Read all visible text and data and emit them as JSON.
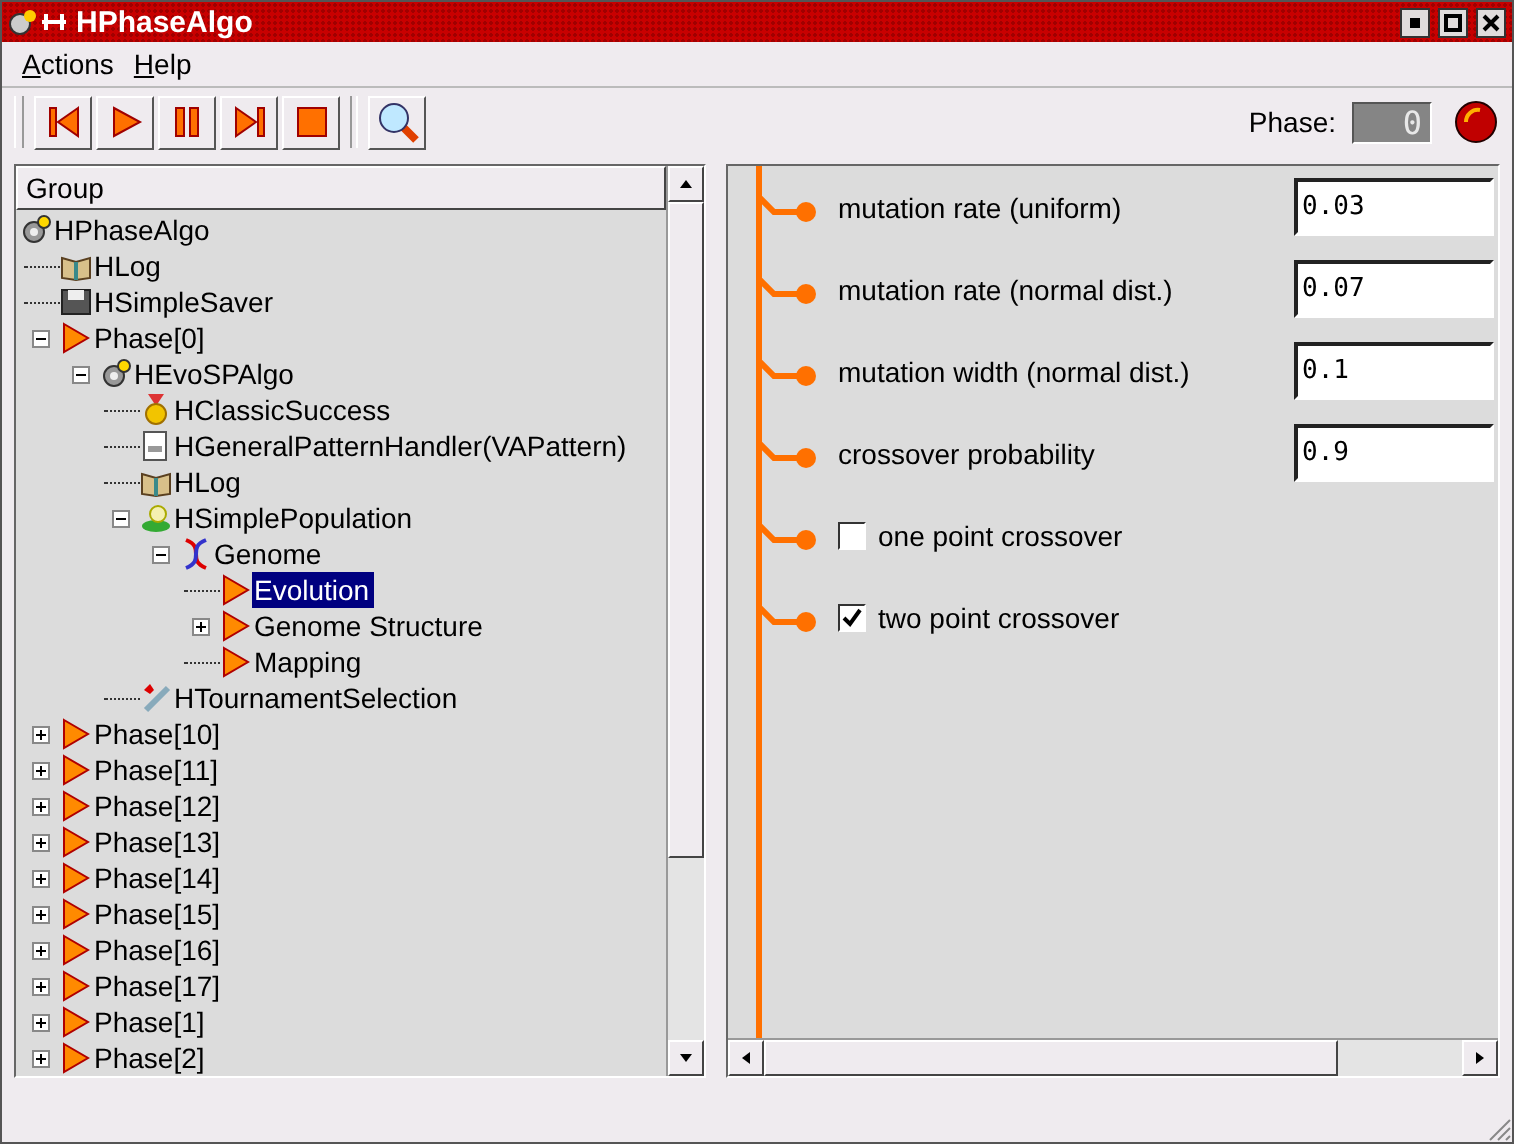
{
  "window": {
    "title": "HPhaseAlgo"
  },
  "menu": [
    {
      "label": "Actions"
    },
    {
      "label": "Help"
    }
  ],
  "toolbar": {
    "phase_label": "Phase:",
    "phase_value": "0"
  },
  "tree": {
    "column": "Group",
    "items": [
      {
        "label": "HPhaseAlgo",
        "kind": "algo",
        "selected": false,
        "children": [
          {
            "label": "HLog",
            "kind": "log",
            "selected": false
          },
          {
            "label": "HSimpleSaver",
            "kind": "saver",
            "selected": false
          },
          {
            "label": "Phase[0]",
            "kind": "phase",
            "selected": false,
            "expanded": true,
            "children": [
              {
                "label": "HEvoSPAlgo",
                "kind": "algo",
                "selected": false,
                "expanded": true,
                "children": [
                  {
                    "label": "HClassicSuccess",
                    "kind": "success",
                    "selected": false
                  },
                  {
                    "label": "HGeneralPatternHandler(VAPattern)",
                    "kind": "pattern",
                    "selected": false
                  },
                  {
                    "label": "HLog",
                    "kind": "log",
                    "selected": false
                  },
                  {
                    "label": "HSimplePopulation",
                    "kind": "population",
                    "selected": false,
                    "expanded": true,
                    "children": [
                      {
                        "label": "Genome",
                        "kind": "genome",
                        "selected": false,
                        "expanded": true,
                        "children": [
                          {
                            "label": "Evolution",
                            "kind": "phase",
                            "selected": true
                          },
                          {
                            "label": "Genome Structure",
                            "kind": "phase",
                            "selected": false,
                            "expanded": false
                          },
                          {
                            "label": "Mapping",
                            "kind": "phase",
                            "selected": false
                          }
                        ]
                      }
                    ]
                  },
                  {
                    "label": "HTournamentSelection",
                    "kind": "selection",
                    "selected": false
                  }
                ]
              }
            ]
          },
          {
            "label": "Phase[10]",
            "kind": "phase",
            "selected": false,
            "expanded": false
          },
          {
            "label": "Phase[11]",
            "kind": "phase",
            "selected": false,
            "expanded": false
          },
          {
            "label": "Phase[12]",
            "kind": "phase",
            "selected": false,
            "expanded": false
          },
          {
            "label": "Phase[13]",
            "kind": "phase",
            "selected": false,
            "expanded": false
          },
          {
            "label": "Phase[14]",
            "kind": "phase",
            "selected": false,
            "expanded": false
          },
          {
            "label": "Phase[15]",
            "kind": "phase",
            "selected": false,
            "expanded": false
          },
          {
            "label": "Phase[16]",
            "kind": "phase",
            "selected": false,
            "expanded": false
          },
          {
            "label": "Phase[17]",
            "kind": "phase",
            "selected": false,
            "expanded": false
          },
          {
            "label": "Phase[1]",
            "kind": "phase",
            "selected": false,
            "expanded": false
          },
          {
            "label": "Phase[2]",
            "kind": "phase",
            "selected": false,
            "expanded": false
          }
        ]
      }
    ]
  },
  "parameters": [
    {
      "kind": "number",
      "label": "mutation rate (uniform)",
      "value": "0.03"
    },
    {
      "kind": "number",
      "label": "mutation rate (normal dist.)",
      "value": "0.07"
    },
    {
      "kind": "number",
      "label": "mutation width (normal dist.)",
      "value": "0.1"
    },
    {
      "kind": "number",
      "label": "crossover probability",
      "value": "0.9"
    },
    {
      "kind": "checkbox",
      "label": "one point crossover",
      "checked": false
    },
    {
      "kind": "checkbox",
      "label": "two point crossover",
      "checked": true
    }
  ]
}
